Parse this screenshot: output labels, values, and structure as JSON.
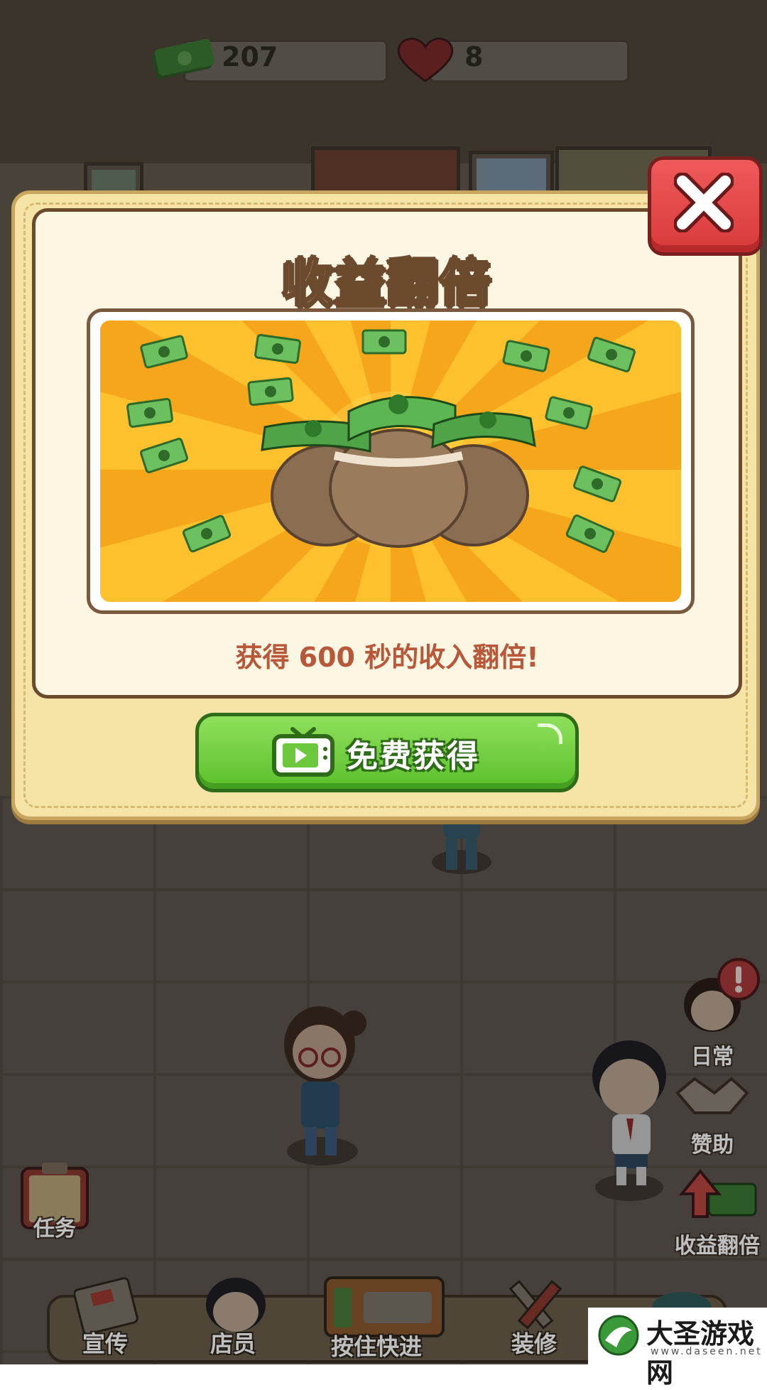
{
  "hud": {
    "money": "207",
    "hearts": "8"
  },
  "modal": {
    "title": "收益翻倍",
    "reward_text": "获得 600 秒的收入翻倍!",
    "cta_label": "免费获得",
    "cta_icon": "tv-play-icon",
    "close_icon": "close-icon"
  },
  "side_menu": {
    "daily": "日常",
    "sponsor": "赞助",
    "income_double": "收益翻倍"
  },
  "task_button": "任务",
  "bottom_bar": {
    "promote": "宣传",
    "staff": "店员",
    "fast_forward": "按住快进",
    "renovate": "装修"
  },
  "watermark": {
    "name": "大圣游戏网",
    "url": "www.daseen.net"
  },
  "colors": {
    "modal_bg": "#f6e3a6",
    "panel_bg": "#fdf6e2",
    "reward_text": "#b8583a",
    "cta_green": "#5bbf2b",
    "close_red": "#d93a3a"
  }
}
